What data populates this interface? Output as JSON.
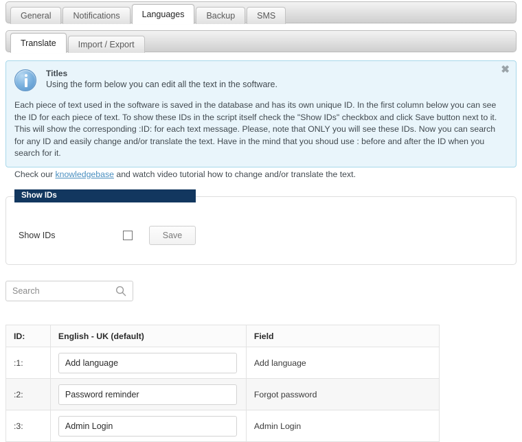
{
  "primary_tabs": [
    {
      "label": "General",
      "active": false
    },
    {
      "label": "Notifications",
      "active": false
    },
    {
      "label": "Languages",
      "active": true
    },
    {
      "label": "Backup",
      "active": false
    },
    {
      "label": "SMS",
      "active": false
    }
  ],
  "secondary_tabs": [
    {
      "label": "Translate",
      "active": true
    },
    {
      "label": "Import / Export",
      "active": false
    }
  ],
  "infobox": {
    "close_label": "✖",
    "title": "Titles",
    "subtitle": "Using the form below you can edit all the text in the software.",
    "body": "Each piece of text used in the software is saved in the database and has its own unique ID. In the first column below you can see the ID for each piece of text. To show these IDs in the script itself check the \"Show IDs\" checkbox and click Save button next to it. This will show the corresponding :ID: for each text message. Please, note that ONLY you will see these IDs. Now you can search for any ID and easily change and/or translate the text. Have in the mind that you shoud use : before and after the ID when you search for it.",
    "footer_pre": "Check our ",
    "footer_link": "knowledgebase",
    "footer_post": " and watch video tutorial how to change and/or translate the text.",
    "border_color": "#a8d8ea",
    "bg_color": "#e9f5fb",
    "link_color": "#4a8fc0"
  },
  "show_ids_panel": {
    "legend": "Show IDs",
    "legend_bg": "#12375f",
    "label": "Show IDs",
    "checkbox_checked": false,
    "save_label": "Save"
  },
  "search": {
    "placeholder": "Search",
    "value": "",
    "icon": "search-icon"
  },
  "table": {
    "headers": [
      "ID:",
      "English - UK (default)",
      "Field"
    ],
    "rows": [
      {
        "id": ":1:",
        "value": "Add language",
        "field": "Add language"
      },
      {
        "id": ":2:",
        "value": "Password reminder",
        "field": "Forgot password"
      },
      {
        "id": ":3:",
        "value": "Admin Login",
        "field": "Admin Login"
      }
    ]
  }
}
